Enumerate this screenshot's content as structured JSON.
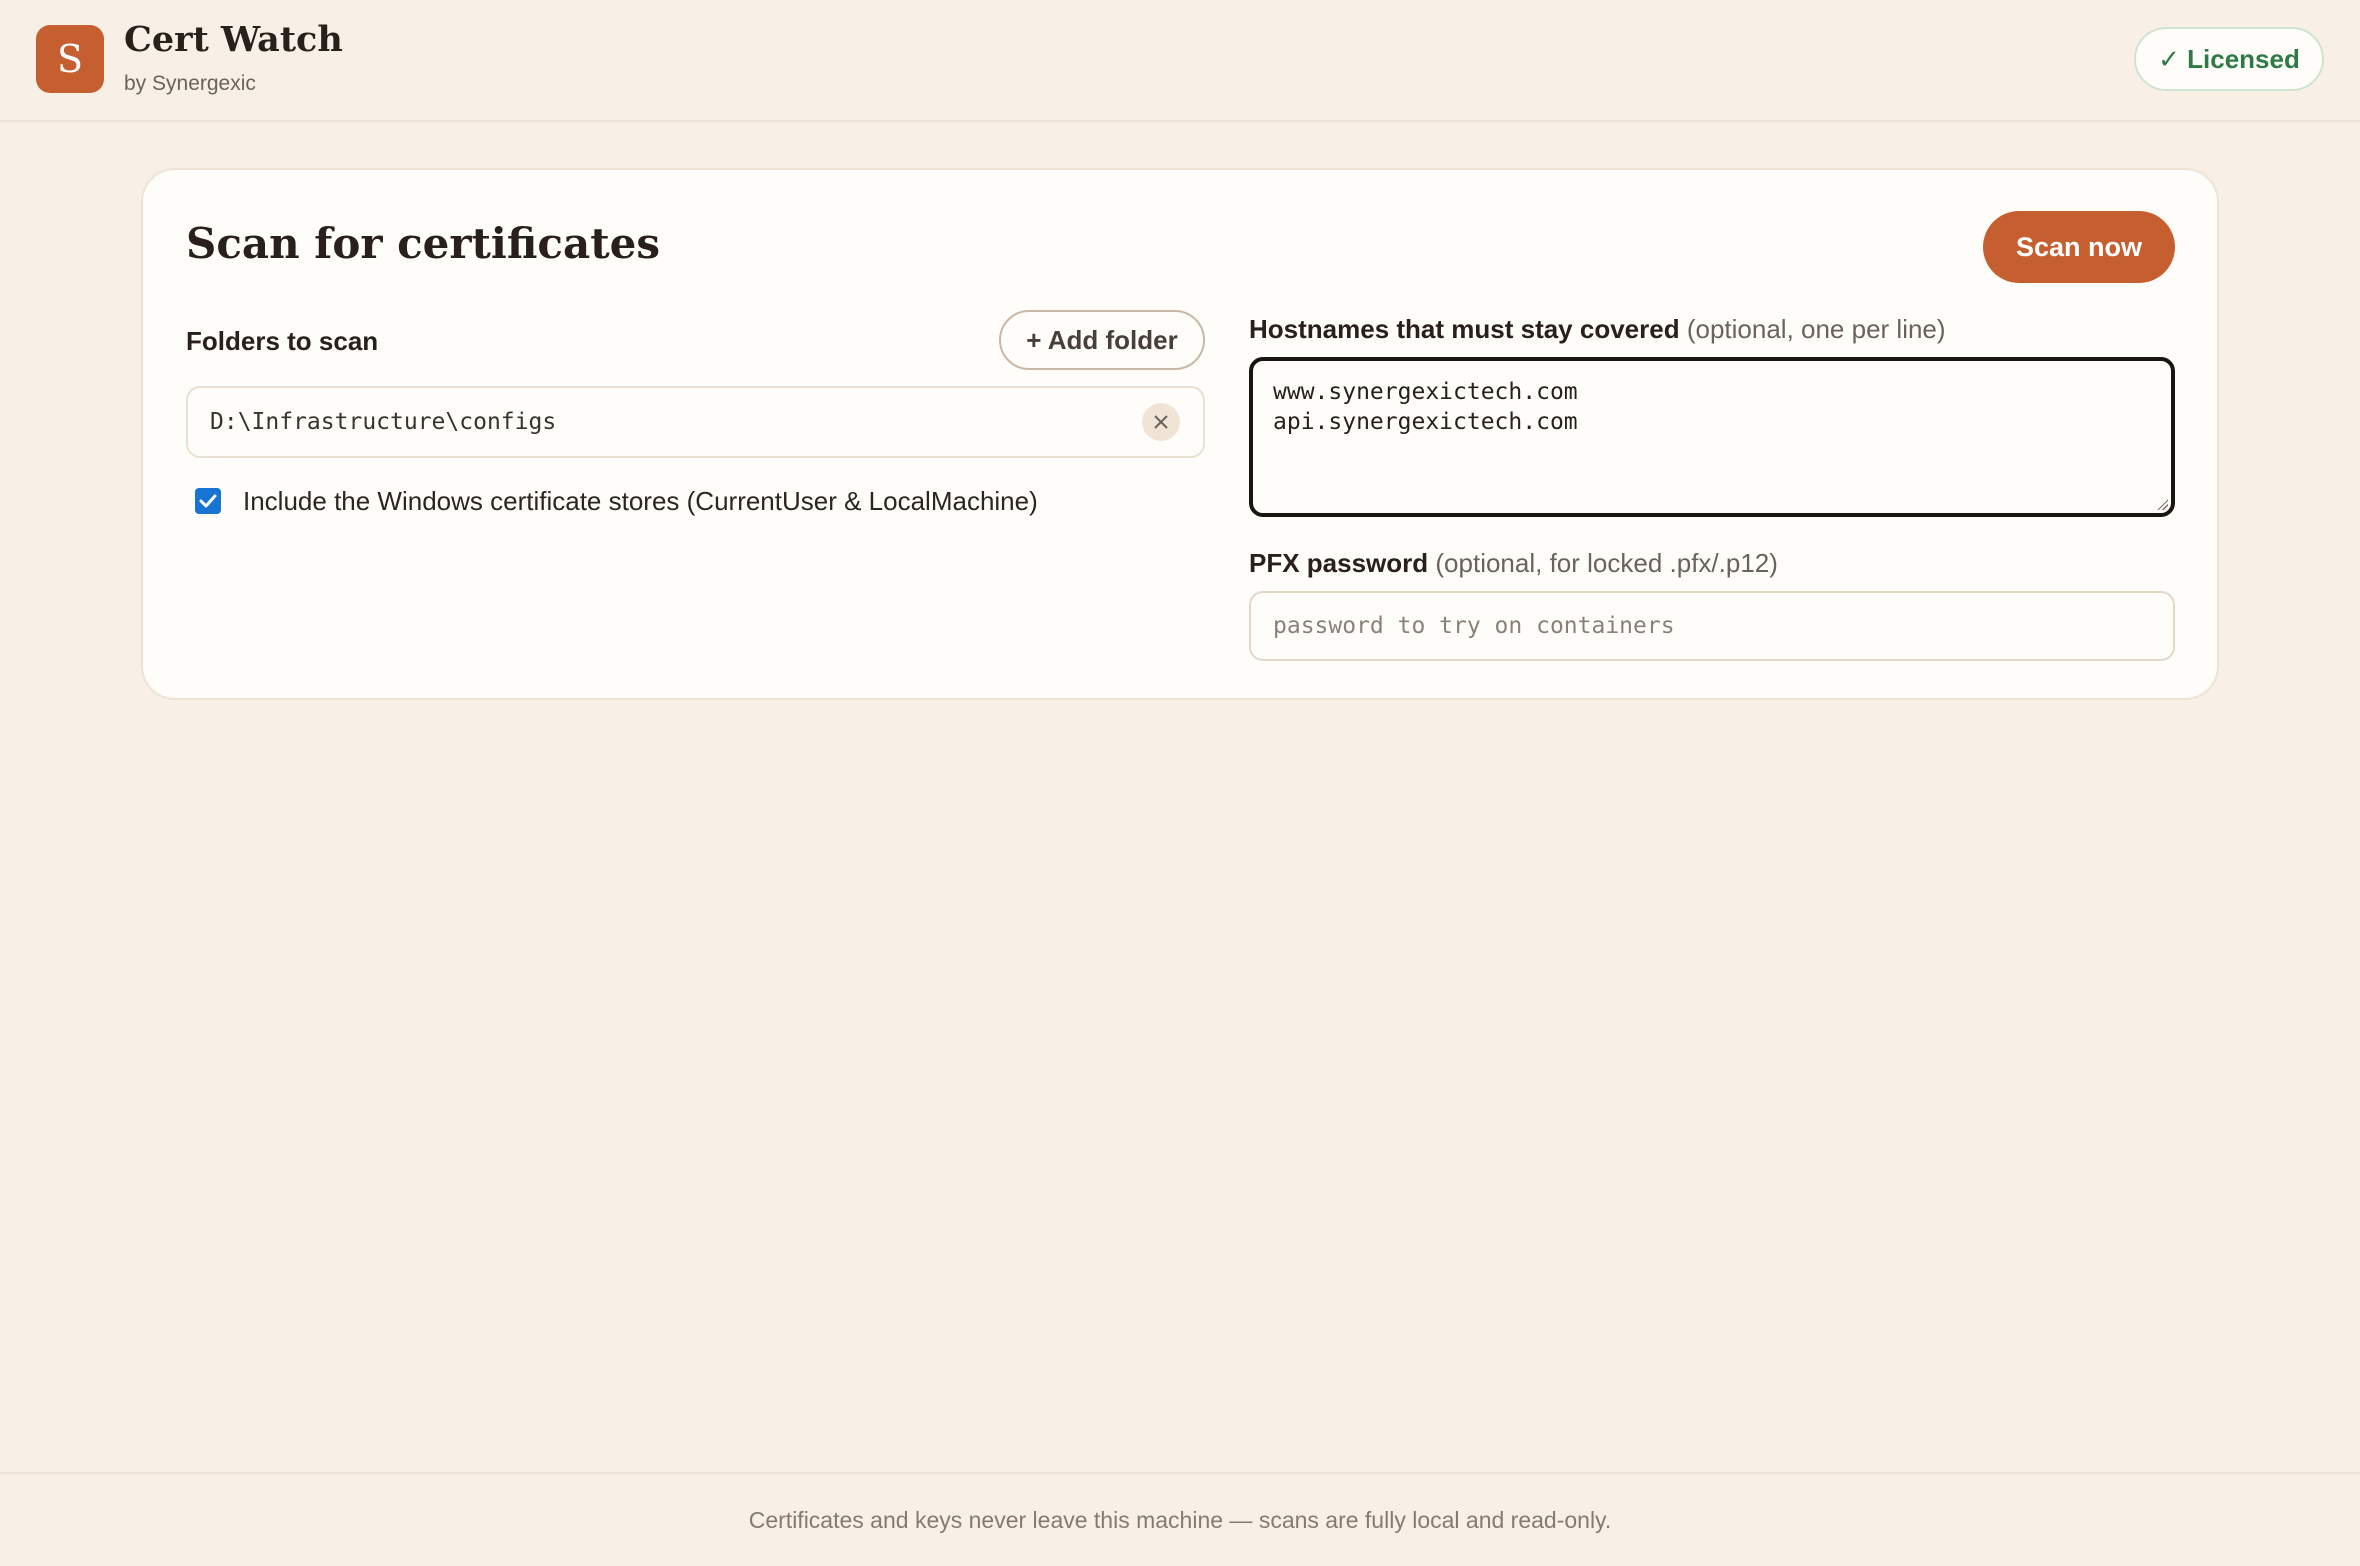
{
  "app": {
    "logo_letter": "S",
    "title": "Cert Watch",
    "subtitle": "by Synergexic",
    "license_badge": "✓ Licensed",
    "accent_color": "#c65f30",
    "license_color": "#2f7a46"
  },
  "scan": {
    "title": "Scan for certificates",
    "scan_button": "Scan now",
    "folders_label": "Folders to scan",
    "add_folder_button": "+ Add folder",
    "folders": [
      {
        "path": "D:\\Infrastructure\\configs",
        "remove_icon": "close-icon"
      }
    ],
    "include_stores": {
      "checked": true,
      "label": "Include the Windows certificate stores (CurrentUser & LocalMachine)"
    },
    "hostnames": {
      "label": "Hostnames that must stay covered",
      "hint": "(optional, one per line)",
      "value": "www.synergexictech.com\napi.synergexictech.com"
    },
    "pfx": {
      "label": "PFX password",
      "hint": "(optional, for locked .pfx/.p12)",
      "placeholder": "password to try on containers",
      "value": ""
    }
  },
  "footer": {
    "text": "Certificates and keys never leave this machine — scans are fully local and read-only."
  }
}
